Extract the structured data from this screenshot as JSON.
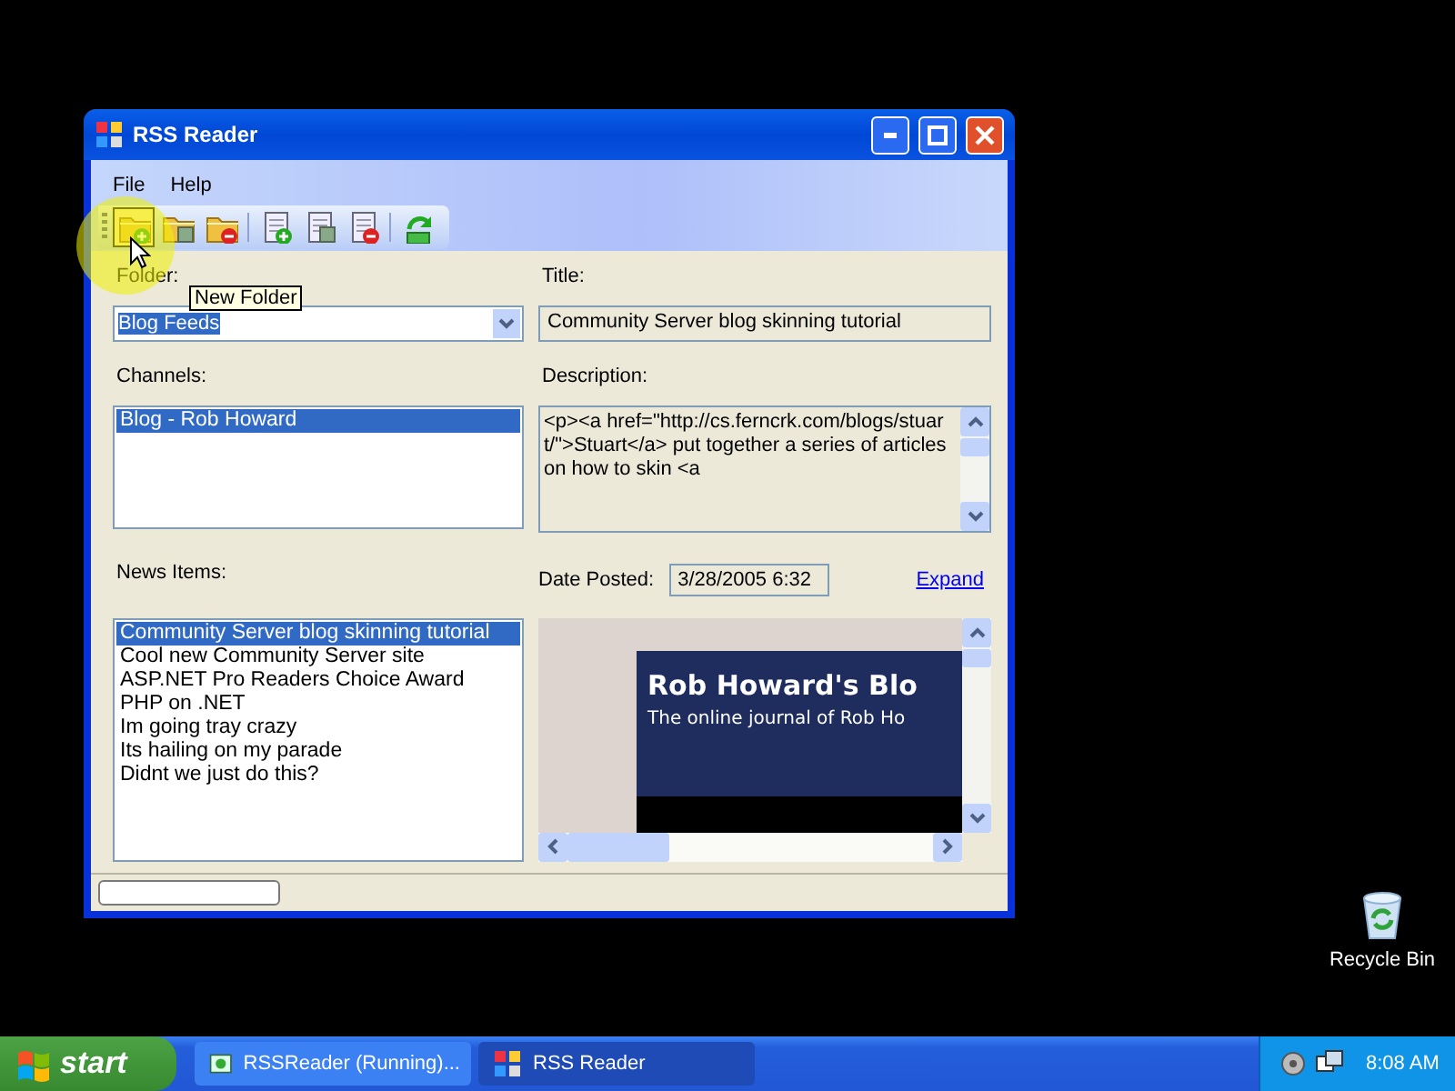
{
  "desktop_icons": [
    {
      "label": "Recycle Bin"
    }
  ],
  "window": {
    "title": "RSS Reader",
    "active": true
  },
  "menu": [
    "File",
    "Help"
  ],
  "toolbar": [
    {
      "kind": "folder-add",
      "hovered": true
    },
    {
      "kind": "folder-edit",
      "hovered": false
    },
    {
      "kind": "folder-remove",
      "hovered": false
    },
    {
      "kind": "separator"
    },
    {
      "kind": "doc-add",
      "hovered": false
    },
    {
      "kind": "doc-edit",
      "hovered": false
    },
    {
      "kind": "doc-remove",
      "hovered": false
    },
    {
      "kind": "separator"
    },
    {
      "kind": "refresh",
      "hovered": false
    }
  ],
  "tooltip": "New Folder",
  "folder": {
    "label": "Folder:",
    "value": "Blog Feeds"
  },
  "channels": {
    "label": "Channels:",
    "items": [
      {
        "text": "Blog - Rob Howard",
        "selected": true
      }
    ]
  },
  "news_items": {
    "label": "News Items:",
    "items": [
      {
        "text": "Community Server blog skinning tutorial",
        "selected": true
      },
      {
        "text": "Cool new Community Server site",
        "selected": false
      },
      {
        "text": "ASP.NET Pro Readers Choice Award",
        "selected": false
      },
      {
        "text": "PHP on .NET",
        "selected": false
      },
      {
        "text": "Im going tray crazy",
        "selected": false
      },
      {
        "text": "Its hailing on my parade",
        "selected": false
      },
      {
        "text": "Didnt we just do this?",
        "selected": false
      }
    ]
  },
  "title": {
    "label": "Title:",
    "value": "Community Server blog skinning tutorial"
  },
  "description": {
    "label": "Description:",
    "value": "<p><a href=\"http://cs.ferncrk.com/blogs/stuart/\">Stuart</a> put together a series of articles on how to skin <a"
  },
  "date_posted": {
    "label": "Date Posted:",
    "value": "3/28/2005 6:32"
  },
  "expand_link": "Expand",
  "preview": {
    "heading": "Rob Howard's Blo",
    "subheading": "The online journal of Rob Ho"
  },
  "taskbar": {
    "start": "start",
    "tasks": [
      {
        "label": "RSSReader (Running)...",
        "selected": false
      },
      {
        "label": "RSS Reader",
        "selected": true
      }
    ],
    "clock": "8:08 AM"
  }
}
